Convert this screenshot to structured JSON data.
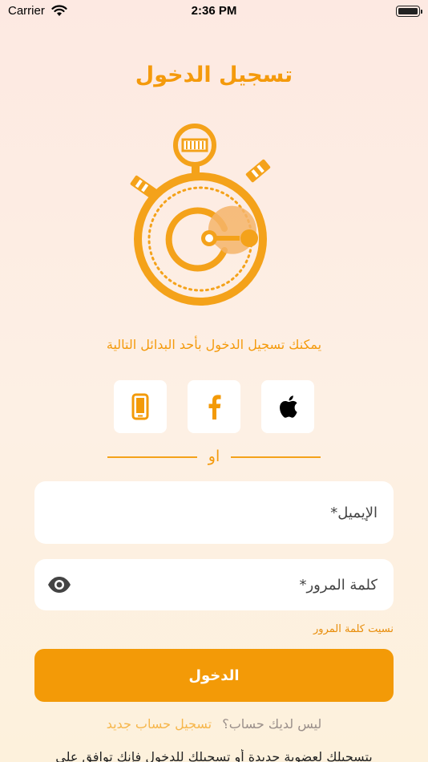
{
  "status_bar": {
    "carrier": "Carrier",
    "time": "2:36 PM"
  },
  "header": {
    "title": "تسجيل الدخول"
  },
  "logo": {
    "icon": "stopwatch-logo-icon",
    "color": "#F4A21A"
  },
  "login_options": {
    "subtitle": "يمكنك تسجيل الدخول بأحد البدائل التالية",
    "buttons": [
      {
        "icon": "phone-icon"
      },
      {
        "icon": "facebook-icon"
      },
      {
        "icon": "apple-icon"
      }
    ],
    "divider_text": "او"
  },
  "form": {
    "email_placeholder": "الإيميل*",
    "password_placeholder": "كلمة المرور*",
    "forgot_password": "نسيت كلمة المرور",
    "login_button": "الدخول"
  },
  "footer": {
    "no_account": "ليس لديك حساب؟",
    "register_link": "تسجيل حساب جديد",
    "terms_text": "بتسجيلك لعضوية جديدة أو تسجيلك للدخول فإنك توافق على"
  },
  "colors": {
    "accent": "#F39A07",
    "background_top": "#FDE9E2",
    "background_bottom": "#FDF1DC"
  }
}
